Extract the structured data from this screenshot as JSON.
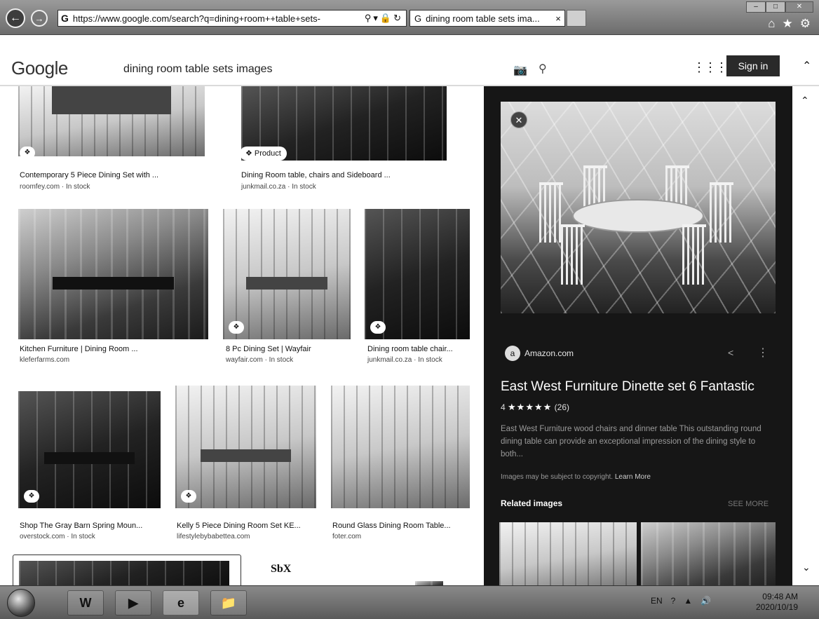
{
  "browser": {
    "address": "https://www.google.com/search?q=dining+room++table+sets-",
    "tab_title": "dining room table sets ima...",
    "tab_close": "×"
  },
  "google": {
    "logo": "Google",
    "query": "dining room  table sets images",
    "sign_in": "Sign in"
  },
  "results": [
    {
      "title": "Contemporary 5 Piece Dining Set with ...",
      "source": "roomfey.com · In stock"
    },
    {
      "title": "Dining Room table, chairs and Sideboard ...",
      "source": "junkmail.co.za · In stock",
      "badge": "Product"
    },
    {
      "title": "Kitchen Furniture | Dining Room ...",
      "source": "kleferfarms.com"
    },
    {
      "title": "8 Pc Dining Set | Wayfair",
      "source": "wayfair.com · In stock"
    },
    {
      "title": "Dining room table chair...",
      "source": "junkmail.co.za · In stock"
    },
    {
      "title": "Shop The Gray Barn Spring Moun...",
      "source": "overstock.com · In stock"
    },
    {
      "title": "Kelly 5 Piece Dining Room Set KE...",
      "source": "lifestylebybabettea.com"
    },
    {
      "title": "Round Glass Dining Room Table...",
      "source": "foter.com"
    }
  ],
  "partial_label": "SbX",
  "preview": {
    "source": "Amazon.com",
    "title": "East West Furniture Dinette set 6 Fantastic",
    "rating_value": "4",
    "stars": "★★★★★",
    "rating_count": "(26)",
    "description": "East West Furniture wood chairs and dinner table This outstanding round dining table can provide an exceptional impression of the dining style to both...",
    "copyright": "Images may be subject to copyright.",
    "learn_more": "Learn More",
    "related_label": "Related images",
    "see_more": "SEE MORE"
  },
  "taskbar": {
    "word_label": "W",
    "tray_lang": "EN",
    "time": "09:48 AM",
    "date": "2020/10/19"
  }
}
